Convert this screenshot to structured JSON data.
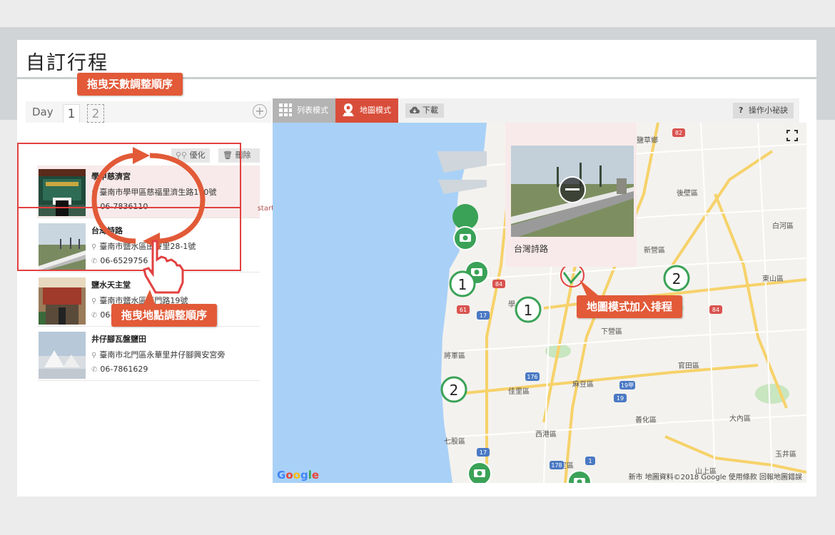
{
  "page": {
    "title": "自訂行程"
  },
  "days": {
    "label": "Day",
    "tabs": [
      "1",
      "2"
    ],
    "add": "+"
  },
  "actions": {
    "optimize": "優化",
    "delete": "刪除"
  },
  "pois": [
    {
      "name": "學甲慈濟宮",
      "address": "臺南市學甲區慈福里濟生路170號",
      "phone": "06-7836110"
    },
    {
      "name": "台灣詩路",
      "address": "臺南市鹽水區田寮里28-1號",
      "phone": "06-6529756"
    },
    {
      "name": "鹽水天主堂",
      "address": "臺南市鹽水區西門路19號",
      "phone": "06-6521127"
    },
    {
      "name": "井仔腳瓦盤鹽田",
      "address": "臺南市北門區永華里井仔腳興安宮旁",
      "phone": "06-7861629"
    }
  ],
  "start_tag": "start",
  "toolbar": {
    "list_mode": "列表模式",
    "map_mode": "地圖模式",
    "download": "下載",
    "tips": "操作小祕訣"
  },
  "map": {
    "popup_label": "台灣詩路",
    "google": "Google",
    "footer": "新市  地圖資料©2018 Google   使用條款   回報地圖錯誤",
    "place_labels": [
      "鹽草鄉",
      "後壁區",
      "白河區",
      "東山區",
      "新營區",
      "下營區",
      "官田區",
      "將軍區",
      "佳里區",
      "麻豆區",
      "善化區",
      "大內區",
      "七股區",
      "西港區",
      "安定區",
      "玉井區",
      "山上區",
      "學"
    ],
    "route_numbers": [
      "82",
      "84",
      "61",
      "17",
      "84",
      "19",
      "19甲",
      "17",
      "176",
      "178",
      "1"
    ],
    "marker_numbers": [
      "1",
      "1",
      "2",
      "2"
    ]
  },
  "callouts": {
    "drag_days": "拖曳天數調整順序",
    "drag_places": "拖曳地點調整順序",
    "map_add": "地圖模式加入排程"
  },
  "colors": {
    "accent": "#d94e3a",
    "callout": "#e25a38",
    "marker_green": "#3aa257",
    "sea": "#a9d1f7"
  }
}
